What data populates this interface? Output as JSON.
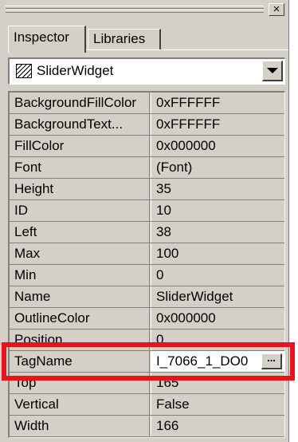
{
  "window": {
    "close_label": "×"
  },
  "tabs": [
    {
      "label": "Inspector",
      "active": true
    },
    {
      "label": "Libraries",
      "active": false
    }
  ],
  "selector": {
    "icon": "widget-hatch-icon",
    "value": "SliderWidget"
  },
  "properties": [
    {
      "name": "BackgroundFillColor",
      "value": "0xFFFFFF"
    },
    {
      "name": "BackgroundText...",
      "value": "0xFFFFFF"
    },
    {
      "name": "FillColor",
      "value": "0x000000"
    },
    {
      "name": "Font",
      "value": "(Font)"
    },
    {
      "name": "Height",
      "value": "35"
    },
    {
      "name": "ID",
      "value": "10"
    },
    {
      "name": "Left",
      "value": "38"
    },
    {
      "name": "Max",
      "value": "100"
    },
    {
      "name": "Min",
      "value": "0"
    },
    {
      "name": "Name",
      "value": "SliderWidget"
    },
    {
      "name": "OutlineColor",
      "value": "0x000000"
    },
    {
      "name": "Position",
      "value": "0"
    },
    {
      "name": "TagName",
      "value": "I_7066_1_DO0",
      "editing": true,
      "button_label": "..."
    },
    {
      "name": "Top",
      "value": "165"
    },
    {
      "name": "Vertical",
      "value": "False"
    },
    {
      "name": "Width",
      "value": "166"
    }
  ],
  "colors": {
    "highlight": "#e8141c",
    "face": "#d4d0c8"
  }
}
